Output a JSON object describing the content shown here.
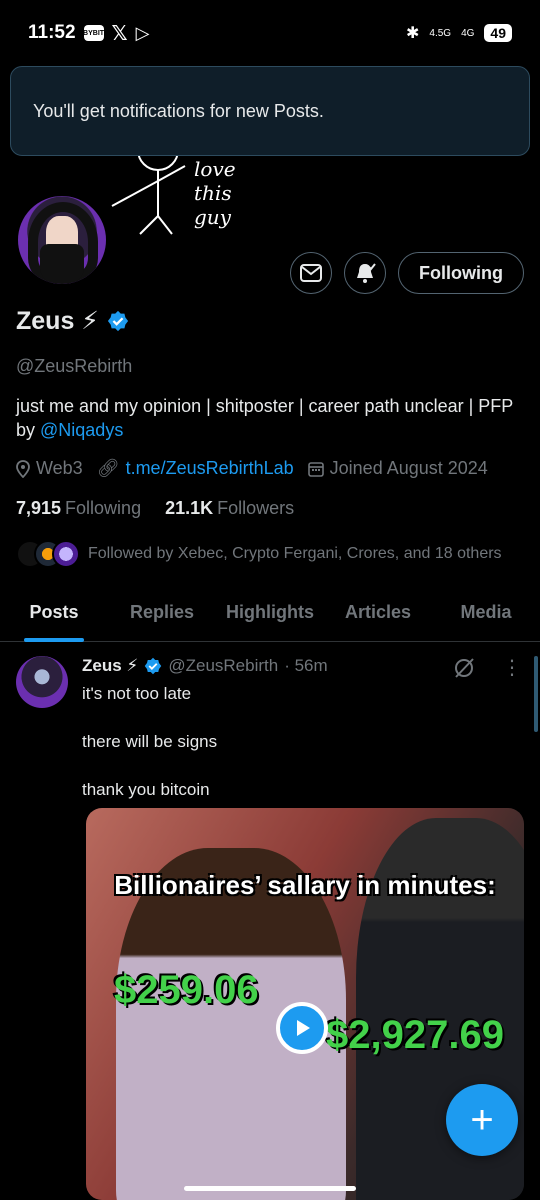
{
  "status": {
    "time": "11:52",
    "chip_label": "BYBIT",
    "network1": "4.5G",
    "network2": "4G",
    "battery": "49"
  },
  "toast": {
    "text": "You'll get notifications for new Posts."
  },
  "banner": {
    "doodle_text": "love this guy"
  },
  "profile": {
    "name": "Zeus ⚡",
    "handle": "@ZeusRebirth",
    "bio_main": "just me and my opinion | shitposter | career path unclear | PFP by ",
    "bio_link": "@Niqadys",
    "location": "Web3",
    "website": "t.me/ZeusRebirthLab",
    "joined": "Joined August 2024",
    "following_count": "7,915",
    "following_label": "Following",
    "followers_count": "21.1K",
    "followers_label": "Followers",
    "followed_by": "Followed by Xebec, Crypto Fergani, Crores, and 18 others",
    "follow_button": "Following"
  },
  "tabs": [
    {
      "label": "Posts"
    },
    {
      "label": "Replies"
    },
    {
      "label": "Highlights"
    },
    {
      "label": "Articles"
    },
    {
      "label": "Media"
    }
  ],
  "post": {
    "author": "Zeus ⚡",
    "handle": "@ZeusRebirth",
    "time": "· 56m",
    "lines": [
      "it's not too late",
      "there will be signs",
      "thank you bitcoin"
    ],
    "media_caption": "Billionaires’ sallary in minutes:",
    "price1": "$259.06",
    "price2": "$2,927.69"
  },
  "colors": {
    "accent": "#1d9bf0",
    "bg": "#000000",
    "muted": "#71767b",
    "green": "#43d14a"
  }
}
